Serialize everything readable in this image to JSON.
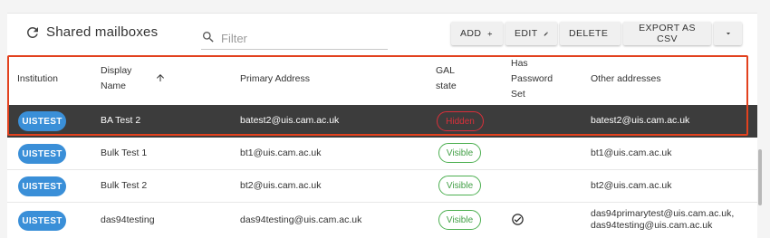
{
  "header": {
    "title": "Shared mailboxes",
    "filter_placeholder": "Filter"
  },
  "toolbar": {
    "add_label": "ADD",
    "edit_label": "EDIT",
    "delete_label": "DELETE",
    "export_label": "EXPORT AS CSV"
  },
  "columns": {
    "institution": "Institution",
    "display_name_line1": "Display",
    "display_name_line2": "Name",
    "primary_address": "Primary Address",
    "gal_line1": "GAL",
    "gal_line2": "state",
    "password_line1": "Has",
    "password_line2": "Password",
    "password_line3": "Set",
    "other_addresses": "Other addresses"
  },
  "rows": [
    {
      "institution": "UISTEST",
      "name": "BA Test 2",
      "primary": "batest2@uis.cam.ac.uk",
      "gal": "Hidden",
      "password_set": false,
      "other_1": "batest2@uis.cam.ac.uk",
      "other_2": "",
      "selected": true
    },
    {
      "institution": "UISTEST",
      "name": "Bulk Test 1",
      "primary": "bt1@uis.cam.ac.uk",
      "gal": "Visible",
      "password_set": false,
      "other_1": "bt1@uis.cam.ac.uk",
      "other_2": ""
    },
    {
      "institution": "UISTEST",
      "name": "Bulk Test 2",
      "primary": "bt2@uis.cam.ac.uk",
      "gal": "Visible",
      "password_set": false,
      "other_1": "bt2@uis.cam.ac.uk",
      "other_2": ""
    },
    {
      "institution": "UISTEST",
      "name": "das94testing",
      "primary": "das94testing@uis.cam.ac.uk",
      "gal": "Visible",
      "password_set": true,
      "other_1": "das94primarytest@uis.cam.ac.uk,",
      "other_2": "das94testing@uis.cam.ac.uk"
    }
  ],
  "colors": {
    "chip": "#3a8fd8",
    "visible": "#43a047",
    "hidden": "#d9303a",
    "selected_row": "#3c3c3c",
    "highlight": "#e2411e"
  },
  "icons": {
    "refresh": "refresh-icon",
    "search": "search-icon",
    "add": "plus-icon",
    "edit": "pencil-icon",
    "delete": "trash-icon",
    "more": "caret-down-icon",
    "sort": "arrow-up-icon",
    "password": "check-circle-icon"
  }
}
